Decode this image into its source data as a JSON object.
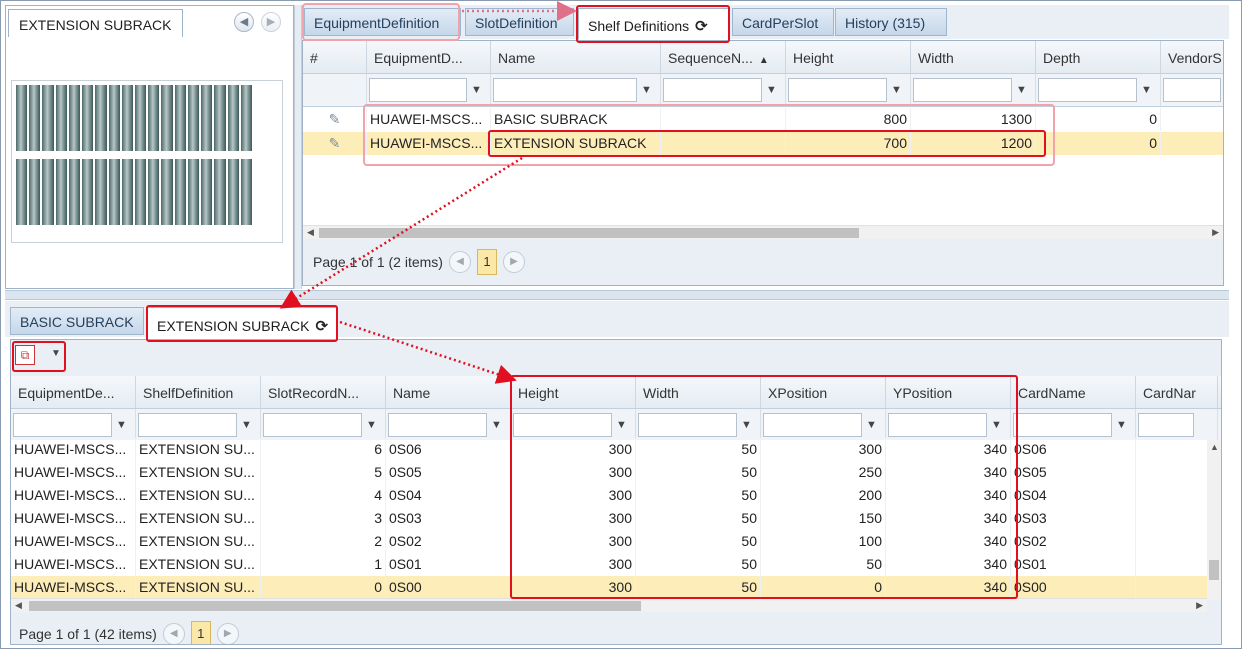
{
  "preview": {
    "tab_label": "EXTENSION SUBRACK",
    "prev_icon": "chevron-left-icon",
    "next_icon": "chevron-right-icon"
  },
  "top_tabs": {
    "items": [
      {
        "label": "EquipmentDefinition"
      },
      {
        "label": "SlotDefinition"
      },
      {
        "label": "Shelf Definitions"
      },
      {
        "label": "CardPerSlot"
      },
      {
        "label": "History (315)"
      }
    ],
    "active_index": 2,
    "refresh_icon": "refresh-icon"
  },
  "shelf_grid": {
    "columns": [
      "#",
      "EquipmentD...",
      "Name",
      "SequenceN...",
      "Height",
      "Width",
      "Depth",
      "VendorS"
    ],
    "rows": [
      {
        "equipment": "HUAWEI-MSCS...",
        "name": "BASIC SUBRACK",
        "height": "800",
        "width": "1300",
        "depth": "0"
      },
      {
        "equipment": "HUAWEI-MSCS...",
        "name": "EXTENSION SUBRACK",
        "height": "700",
        "width": "1200",
        "depth": "0"
      }
    ],
    "selected_row": 1,
    "pager_text": "Page 1 of 1 (2 items)",
    "page": "1"
  },
  "bottom_tabs": {
    "items": [
      {
        "label": "BASIC SUBRACK"
      },
      {
        "label": "EXTENSION SUBRACK"
      }
    ],
    "active_index": 1
  },
  "slot_grid": {
    "toolbar_icon": "expand-collapse-icon",
    "columns": [
      "EquipmentDe...",
      "ShelfDefinition",
      "SlotRecordN...",
      "Name",
      "Height",
      "Width",
      "XPosition",
      "YPosition",
      "CardName",
      "CardNar"
    ],
    "rows": [
      {
        "equipment": "HUAWEI-MSCS...",
        "shelf": "EXTENSION SU...",
        "slot": "6",
        "name": "0S06",
        "height": "300",
        "width": "50",
        "x": "300",
        "y": "340",
        "card": "0S06"
      },
      {
        "equipment": "HUAWEI-MSCS...",
        "shelf": "EXTENSION SU...",
        "slot": "5",
        "name": "0S05",
        "height": "300",
        "width": "50",
        "x": "250",
        "y": "340",
        "card": "0S05"
      },
      {
        "equipment": "HUAWEI-MSCS...",
        "shelf": "EXTENSION SU...",
        "slot": "4",
        "name": "0S04",
        "height": "300",
        "width": "50",
        "x": "200",
        "y": "340",
        "card": "0S04"
      },
      {
        "equipment": "HUAWEI-MSCS...",
        "shelf": "EXTENSION SU...",
        "slot": "3",
        "name": "0S03",
        "height": "300",
        "width": "50",
        "x": "150",
        "y": "340",
        "card": "0S03"
      },
      {
        "equipment": "HUAWEI-MSCS...",
        "shelf": "EXTENSION SU...",
        "slot": "2",
        "name": "0S02",
        "height": "300",
        "width": "50",
        "x": "100",
        "y": "340",
        "card": "0S02"
      },
      {
        "equipment": "HUAWEI-MSCS...",
        "shelf": "EXTENSION SU...",
        "slot": "1",
        "name": "0S01",
        "height": "300",
        "width": "50",
        "x": "50",
        "y": "340",
        "card": "0S01"
      },
      {
        "equipment": "HUAWEI-MSCS...",
        "shelf": "EXTENSION SU...",
        "slot": "0",
        "name": "0S00",
        "height": "300",
        "width": "50",
        "x": "0",
        "y": "340",
        "card": "0S00"
      }
    ],
    "selected_row": 6,
    "pager_text": "Page 1 of 1 (42 items)",
    "page": "1"
  },
  "colors": {
    "highlight": "#e01020",
    "selected_row": "#fdedb9",
    "tab_bg": "#c6d7ea"
  }
}
